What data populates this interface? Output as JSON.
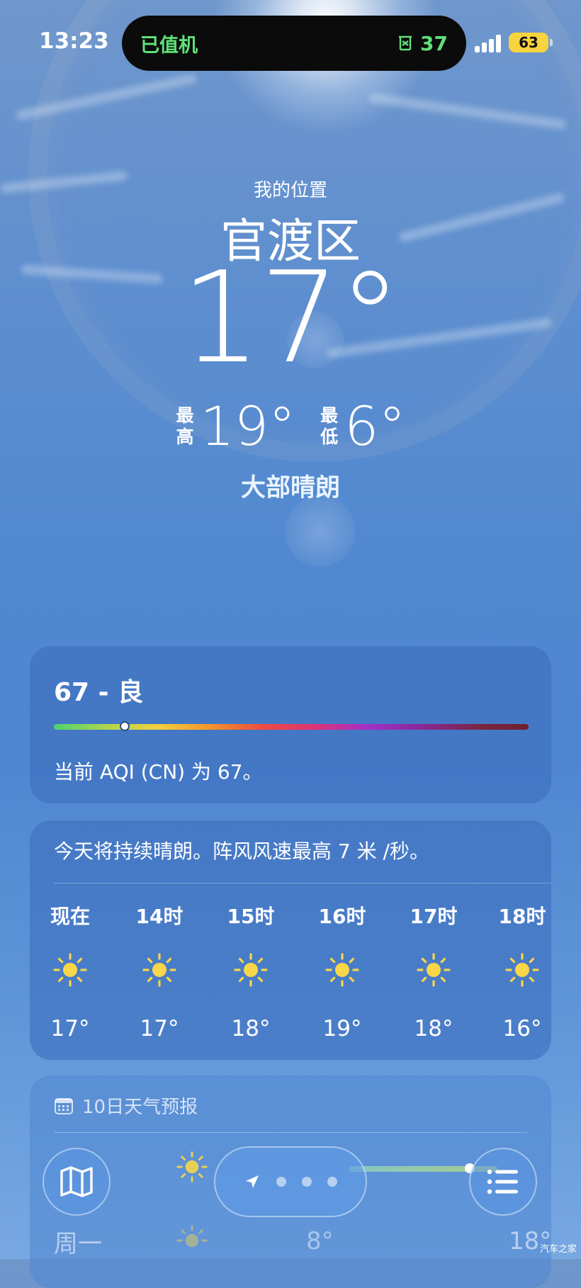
{
  "status_bar": {
    "time": "13:23",
    "island_left": "已值机",
    "island_right_value": "37",
    "battery": "63"
  },
  "location": {
    "label": "我的位置",
    "city": "官渡区",
    "temperature": "17°",
    "high_label": "最高",
    "high_value": "19°",
    "low_label": "最低",
    "low_value": "6°",
    "condition": "大部晴朗"
  },
  "aqi": {
    "title": "67 - 良",
    "value": 67,
    "description": "当前 AQI (CN) 为 67。"
  },
  "hourly": {
    "summary": "今天将持续晴朗。阵风风速最高 7 米 /秒。",
    "items": [
      {
        "time": "现在",
        "icon": "sun-icon",
        "temp": "17°"
      },
      {
        "time": "14时",
        "icon": "sun-icon",
        "temp": "17°"
      },
      {
        "time": "15时",
        "icon": "sun-icon",
        "temp": "18°"
      },
      {
        "time": "16时",
        "icon": "sun-icon",
        "temp": "19°"
      },
      {
        "time": "17时",
        "icon": "sun-icon",
        "temp": "18°"
      },
      {
        "time": "18时",
        "icon": "sun-icon",
        "temp": "16°"
      }
    ]
  },
  "forecast": {
    "title": "10日天气预报",
    "day": "周一",
    "low": "8°",
    "high": "18°"
  },
  "toolbar": {
    "map_icon": "map-icon",
    "location_icon": "location-arrow-icon",
    "list_icon": "list-icon"
  },
  "watermark": "汽车之家",
  "colors": {
    "island_text": "#5fe07a",
    "battery": "#f6d33f",
    "sun": "#f7d64a"
  }
}
